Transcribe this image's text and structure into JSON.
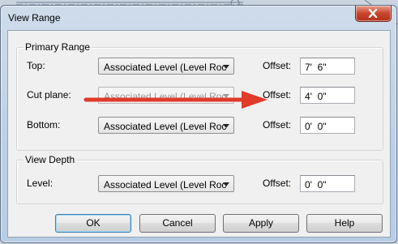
{
  "dialog": {
    "title": "View Range"
  },
  "primary_range": {
    "group_label": "Primary Range",
    "rows": [
      {
        "label": "Top:",
        "level_value": "Associated Level (Level Roc",
        "offset_label": "Offset:",
        "offset_value": "7'  6\"",
        "disabled": false
      },
      {
        "label": "Cut plane:",
        "level_value": "Associated Level (Level Roc",
        "offset_label": "Offset:",
        "offset_value": "4'  0\"",
        "disabled": true
      },
      {
        "label": "Bottom:",
        "level_value": "Associated Level (Level Roc",
        "offset_label": "Offset:",
        "offset_value": "0'  0\"",
        "disabled": false
      }
    ]
  },
  "view_depth": {
    "group_label": "View Depth",
    "level_label": "Level:",
    "level_value": "Associated Level (Level Roc",
    "offset_label": "Offset:",
    "offset_value": "0'  0\""
  },
  "buttons": {
    "ok": "OK",
    "cancel": "Cancel",
    "apply": "Apply",
    "help": "Help"
  },
  "colors": {
    "annotation_arrow": "#e03a2a",
    "close_button": "#c9452c"
  },
  "icons": {
    "close": "close-icon",
    "dropdown": "chevron-down-icon",
    "annotation": "red-arrow-icon"
  }
}
